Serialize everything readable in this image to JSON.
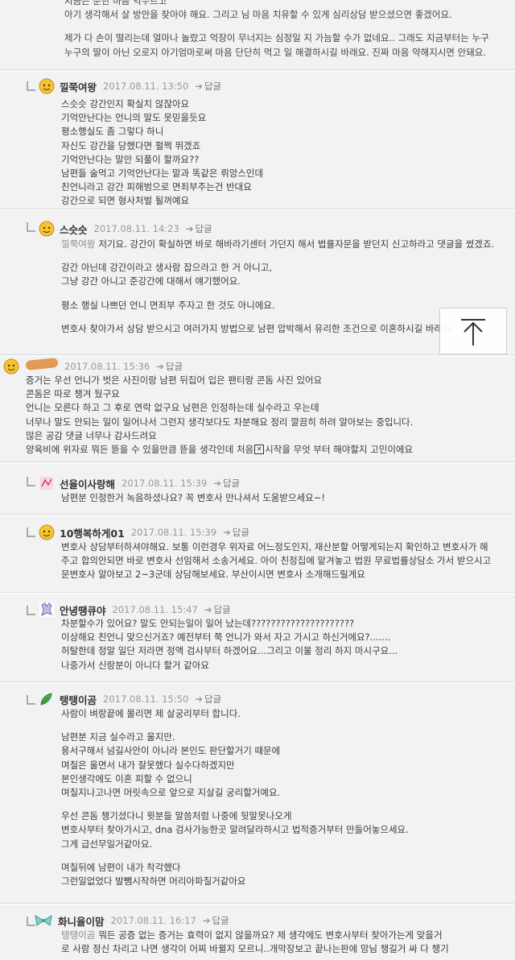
{
  "top": {
    "lines": [
      "지금은 분한 마음 억누르고",
      "아기 생각해서 살 방안을 찾아야 해요. 그리고 님 마음 치유할 수 있게 심리상담 받으셨으면 좋겠어요.",
      "",
      "제가 다 손이 떨리는데 얼마나 놀랐고 억장이 무너지는 심정일 지 가늠할 수가 없네요.. 그래도 지금부터는 누구",
      "누구의 딸이 아닌 오로지 아기엄마로써 마음 단단히 먹고 일 해결하시길 바래요. 진짜 마음 약해지시면 안돼요."
    ]
  },
  "reply_label": "답글",
  "comments": [
    {
      "name": "낄쭉여왕",
      "date": "2017.08.11. 13:50",
      "mention": "",
      "lines": [
        "스슷슷 강간인지 확실치 않잖아요",
        "기억안난다는 언니의 말도 못믿을듯요",
        "평소행실도 좀 그렇다 하니",
        "자신도 강간을 당했다면 펄쩍 뛰겠죠",
        "기억안난다는 말만 되풀이 할까요??",
        "남편들 술먹고 기억안난다는 말과 똑같은 뤼앙스인데",
        "친언니라고 강간 피해범으로 면죄부주는건 반대요",
        "강간으로 되면 형사처벌 될꺼예요"
      ]
    },
    {
      "name": "스슷슷",
      "date": "2017.08.11. 14:23",
      "mention": "낄쭉여왕",
      "lines": [
        "저기요. 강간이 확실하면 바로 해바라기센터 가던지 해서 법률자문을 받던지 신고하라고 댓글을 썼겠죠.",
        "",
        "강간 아닌데 강간이라고 생사람 잡으라고 한 거 아니고,",
        "그냥 강간 아니고 준강간에 대해서 얘기했어요.",
        "",
        "평소 행실 나쁘던 언니 면죄부 주자고 한 것도 아니에요.",
        "",
        "변호사 찾아가서 상담 받으시고 여러가지 방법으로 남편 압박해서 유리한 조건으로 이혼하시길 바래요."
      ]
    },
    {
      "name": "",
      "date": "2017.08.11. 15:36",
      "mention": "",
      "lines": [
        "증거는 우선 언니가 벗은 사진이랑 남편 뒤집어 입은 팬티랑 콘돔 사진 있어요",
        "콘돔은 따로 챙겨 뒀구요",
        "언니는 모른다 하고 그 후로 연락 없구요 남편은 인정하는데 실수라고 우는데",
        "너무나 말도 안되는 일이 일어나서 그런지 생각보다도 차분해요 정리 깔끔히 하려 알아보는 중입니다.",
        "많은 공감 댓글 너무나 감사드려요",
        "양육비에 위자료 뭐든 뜯을 수 있을만큼 뜯을 생각인데 처음",
        "시작을 무엇 부터 해야할지 고민이에요"
      ]
    },
    {
      "name": "선율이사랑해",
      "date": "2017.08.11. 15:39",
      "mention": "",
      "lines": [
        "남편분 인정한거 녹음하셨나요? 꼭 변호사 만나셔서 도움받으세요~!"
      ]
    },
    {
      "name": "10행복하게01",
      "date": "2017.08.11. 15:39",
      "mention": "",
      "lines": [
        "변호사 상담부터하셔야해요. 보통 이런경우 위자료 어느정도인지, 재산분할 어떻게되는지 확인하고 변호사가 해",
        "주고 합의안되면 바로 변호사 선임해서 소송거세요. 아이 친정집에 맡겨놓고 법원 무료법률상담소 가서 받으시고",
        "문변호사 알아보고 2~3군데 상담해보세요. 부산이시면 변호사 소개해드릴게요"
      ]
    },
    {
      "name": "안녕땡큐야",
      "date": "2017.08.11. 15:47",
      "mention": "",
      "lines": [
        "차분할수가 있어요? 말도 안되는일이 일어 났는데?????????????????????",
        "이상해요 친언니 맞으신거죠? 예전부터 쭉 언니가 와서 자고 가시고 하신거에요?.......",
        "허탈한데 정말 일단 저라면 정액 검사부터 하겠어요...그리고 이불 정리 하지 마시구요...",
        "나중가서 신랑분이 아니다 할거 같아요"
      ]
    },
    {
      "name": "탱탱이곰",
      "date": "2017.08.11. 15:50",
      "mention": "",
      "lines": [
        "사람이 벼랑끝에 몰리면 제 살궁리부터 합니다.",
        "",
        "남편분 지금 실수라고 울지만.",
        "용서구해서 넘길사안이 아니라 본인도 판단할거기 때문에",
        "며칠은 울면서 내가 잘못했다 실수다하겠지만",
        "본인생각에도 이혼 피할 수 없으니",
        "며칠지나고나면 머릿속으로 앞으로 지살길 궁리할거예요.",
        "",
        "우선 콘돔 챙기셨다니 윗분들 말씀처럼 나중에 뒷말못나오게",
        "변호사부터 찾아가시고, dna 검사가능한곳 알려달라하시고 법적증거부터 만들어놓으세요.",
        "그게 급선무일거같아요.",
        "",
        "며칠뒤에 남편이 내가 착각했다",
        "그런일없었다 발뺌시작하면 머리아파질거같아요"
      ]
    },
    {
      "name": "화니율이맘",
      "date": "2017.08.11. 16:17",
      "mention": "탱탱이곰",
      "lines": [
        "뭐든 공증 없는 증거는 효력이 없지 않을까요? 제 생각에도 변호사부터 찾아가는게 맞을거",
        "로 사람 정신 차리고 나면 생각이 어찌 바뀔지 모르니..개막장보고 끝나는판에 맘님 챙길거 싸 다 챙기"
      ]
    }
  ],
  "to_top_label": "맨 위로"
}
